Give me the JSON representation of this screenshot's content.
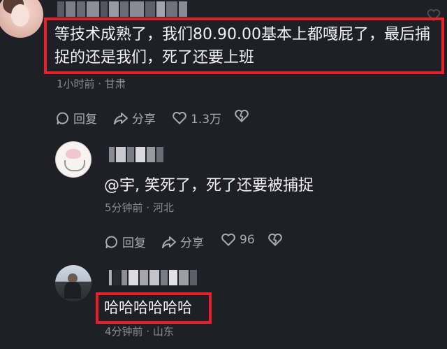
{
  "comments": [
    {
      "text": "等技术成熟了，我们80.90.00基本上都嘎屁了，最后捕捉的还是我们，死了还要上班",
      "meta": "1小时前 · 甘肃",
      "reply_label": "回复",
      "share_label": "分享",
      "like_count": "1.3万"
    },
    {
      "text": "@宇, 笑死了，死了还要被捕捉",
      "meta": "5分钟前 · 河北",
      "reply_label": "回复",
      "share_label": "分享",
      "like_count": "96"
    },
    {
      "text": "哈哈哈哈哈哈",
      "meta": "4分钟前 · 山东"
    }
  ],
  "colors": {
    "background": "#1f1f27",
    "highlight_border": "#e8202a",
    "meta_text": "#8b8b93"
  },
  "icons": [
    "reply-icon",
    "share-icon",
    "heart-icon",
    "dislike-icon",
    "more-heart-icon"
  ]
}
